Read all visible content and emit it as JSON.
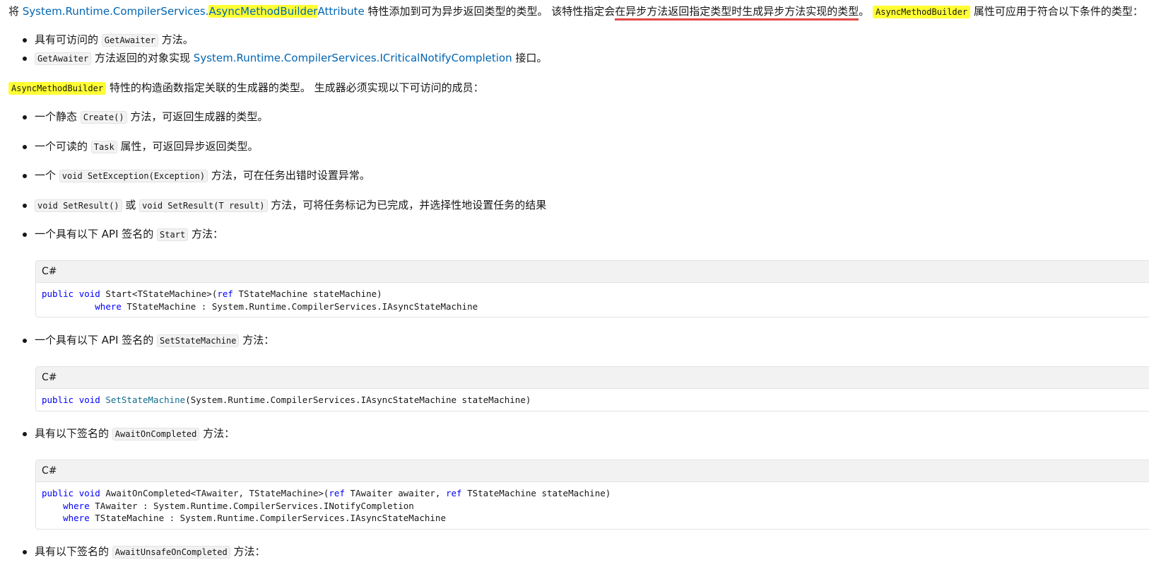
{
  "intro": {
    "prefix": "将 ",
    "link_ns": "System.Runtime.CompilerServices.",
    "link_hl": "AsyncMethodBuilder",
    "link_tail": "Attribute",
    "text1": " 特性添加到可为异步返回类型的类型。 该特性指定会",
    "underlined": "在异步方法返回指定类型时生成异步方法实现的类型",
    "text2": "。 ",
    "code": "AsyncMethodBuilder",
    "text3": " 属性可应用于符合以下条件的类型："
  },
  "conditions": [
    {
      "code": "GetAwaiter",
      "pre": "具有可访问的 ",
      "post": " 方法。"
    },
    {
      "code": "GetAwaiter",
      "pre": "",
      "mid": " 方法返回的对象实现 ",
      "link": "System.Runtime.CompilerServices.ICriticalNotifyCompletion",
      "post": " 接口。"
    }
  ],
  "builder_para": {
    "code": "AsyncMethodBuilder",
    "text": " 特性的构造函数指定关联的生成器的类型。 生成器必须实现以下可访问的成员："
  },
  "members": {
    "create": {
      "pre": "一个静态 ",
      "code": "Create()",
      "post": " 方法，可返回生成器的类型。"
    },
    "task": {
      "pre": "一个可读的 ",
      "code": "Task",
      "post": " 属性，可返回异步返回类型。"
    },
    "setexception": {
      "pre": "一个 ",
      "code": "void SetException(Exception)",
      "post": " 方法，可在任务出错时设置异常。"
    },
    "setresult": {
      "code1": "void SetResult()",
      "mid": " 或 ",
      "code2": "void SetResult(T result)",
      "post": " 方法，可将任务标记为已完成，并选择性地设置任务的结果"
    },
    "start": {
      "pre": "一个具有以下 API 签名的 ",
      "code": "Start",
      "post": " 方法："
    },
    "setstatemachine": {
      "pre": "一个具有以下 API 签名的 ",
      "code": "SetStateMachine",
      "post": " 方法："
    },
    "awaitoncompleted": {
      "pre": "具有以下签名的 ",
      "code": "AwaitOnCompleted",
      "post": " 方法："
    },
    "awaitunsafe": {
      "pre": "具有以下签名的 ",
      "code": "AwaitUnsafeOnCompleted",
      "post": " 方法："
    }
  },
  "code_blocks": {
    "lang": "C#",
    "start": {
      "l1_kw1": "public",
      "l1_kw2": "void",
      "l1_a": " Start<TStateMachine>(",
      "l1_kw3": "ref",
      "l1_b": " TStateMachine stateMachine)",
      "l2_indent": "          ",
      "l2_kw": "where",
      "l2_rest": " TStateMachine : System.Runtime.CompilerServices.IAsyncStateMachine"
    },
    "setstatemachine": {
      "kw1": "public",
      "kw2": "void",
      "fn": "SetStateMachine",
      "rest": "(System.Runtime.CompilerServices.IAsyncStateMachine stateMachine)"
    },
    "awaitoncompleted": {
      "l1_kw1": "public",
      "l1_kw2": "void",
      "l1_a": " AwaitOnCompleted<TAwaiter, TStateMachine>(",
      "l1_kw3": "ref",
      "l1_b": " TAwaiter awaiter, ",
      "l1_kw4": "ref",
      "l1_c": " TStateMachine stateMachine)",
      "l2_indent": "    ",
      "l2_kw": "where",
      "l2_rest": " TAwaiter : System.Runtime.CompilerServices.INotifyCompletion",
      "l3_indent": "    ",
      "l3_kw": "where",
      "l3_rest": " TStateMachine : System.Runtime.CompilerServices.IAsyncStateMachine"
    }
  },
  "colors": {
    "link": "#0065b3",
    "highlight": "#ffff33",
    "underline": "#e04848",
    "keyword": "#0101fd"
  }
}
